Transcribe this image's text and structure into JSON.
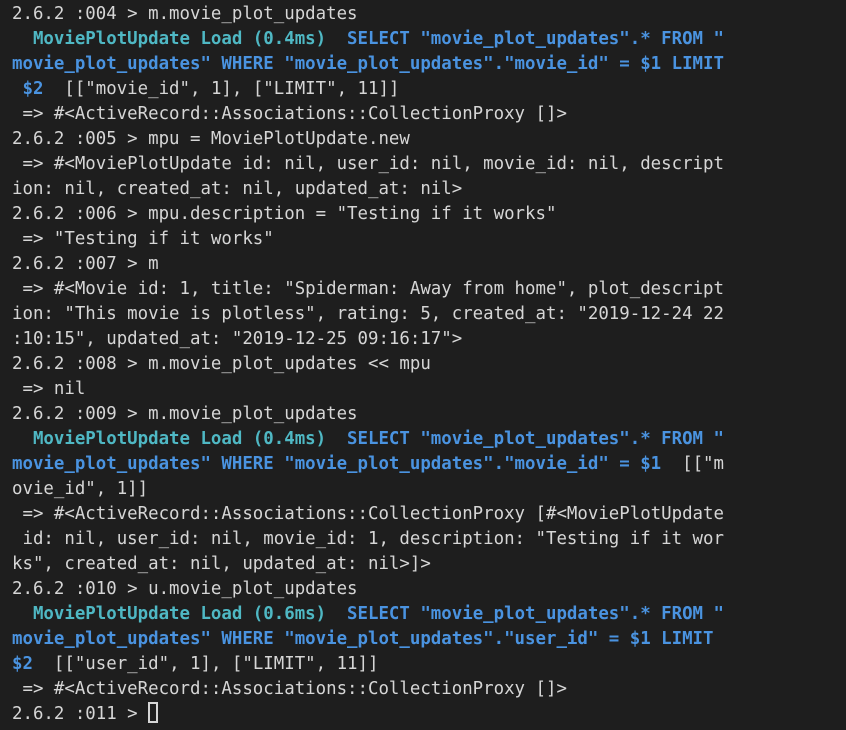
{
  "terminal": {
    "colors": {
      "background": "#1e1e1e",
      "text": "#d6d6d6",
      "sql_label": "#4fb8c4",
      "sql_query": "#4a93e0"
    },
    "lines": [
      {
        "kind": "plain",
        "text": "2.6.2 :004 > m.movie_plot_updates"
      },
      {
        "kind": "sql",
        "label": "  MoviePlotUpdate Load (0.4ms)",
        "query": "  SELECT \"movie_plot_updates\".* FROM \""
      },
      {
        "kind": "sqlcont",
        "query": "movie_plot_updates\" WHERE \"movie_plot_updates\".\"movie_id\" = $1 LIMIT"
      },
      {
        "kind": "sqltail",
        "query": " $2",
        "rest": "  [[\"movie_id\", 1], [\"LIMIT\", 11]]"
      },
      {
        "kind": "plain",
        "text": " => #<ActiveRecord::Associations::CollectionProxy []>"
      },
      {
        "kind": "plain",
        "text": "2.6.2 :005 > mpu = MoviePlotUpdate.new"
      },
      {
        "kind": "plain",
        "text": " => #<MoviePlotUpdate id: nil, user_id: nil, movie_id: nil, descript"
      },
      {
        "kind": "plain",
        "text": "ion: nil, created_at: nil, updated_at: nil>"
      },
      {
        "kind": "plain",
        "text": "2.6.2 :006 > mpu.description = \"Testing if it works\""
      },
      {
        "kind": "plain",
        "text": " => \"Testing if it works\""
      },
      {
        "kind": "plain",
        "text": "2.6.2 :007 > m"
      },
      {
        "kind": "plain",
        "text": " => #<Movie id: 1, title: \"Spiderman: Away from home\", plot_descript"
      },
      {
        "kind": "plain",
        "text": "ion: \"This movie is plotless\", rating: 5, created_at: \"2019-12-24 22"
      },
      {
        "kind": "plain",
        "text": ":10:15\", updated_at: \"2019-12-25 09:16:17\">"
      },
      {
        "kind": "plain",
        "text": "2.6.2 :008 > m.movie_plot_updates << mpu"
      },
      {
        "kind": "plain",
        "text": " => nil"
      },
      {
        "kind": "plain",
        "text": "2.6.2 :009 > m.movie_plot_updates"
      },
      {
        "kind": "sql",
        "label": "  MoviePlotUpdate Load (0.4ms)",
        "query": "  SELECT \"movie_plot_updates\".* FROM \""
      },
      {
        "kind": "sqlmix",
        "query": "movie_plot_updates\" WHERE \"movie_plot_updates\".\"movie_id\" = $1",
        "rest": "  [[\"m"
      },
      {
        "kind": "plain",
        "text": "ovie_id\", 1]]"
      },
      {
        "kind": "plain",
        "text": " => #<ActiveRecord::Associations::CollectionProxy [#<MoviePlotUpdate"
      },
      {
        "kind": "plain",
        "text": " id: nil, user_id: nil, movie_id: 1, description: \"Testing if it wor"
      },
      {
        "kind": "plain",
        "text": "ks\", created_at: nil, updated_at: nil>]>"
      },
      {
        "kind": "plain",
        "text": "2.6.2 :010 > u.movie_plot_updates"
      },
      {
        "kind": "sql",
        "label": "  MoviePlotUpdate Load (0.6ms)",
        "query": "  SELECT \"movie_plot_updates\".* FROM \""
      },
      {
        "kind": "sqlcont",
        "query": "movie_plot_updates\" WHERE \"movie_plot_updates\".\"user_id\" = $1 LIMIT"
      },
      {
        "kind": "sqltail",
        "query": "$2",
        "rest": "  [[\"user_id\", 1], [\"LIMIT\", 11]]"
      },
      {
        "kind": "plain",
        "text": " => #<ActiveRecord::Associations::CollectionProxy []>"
      },
      {
        "kind": "prompt",
        "text": "2.6.2 :011 > "
      }
    ]
  }
}
